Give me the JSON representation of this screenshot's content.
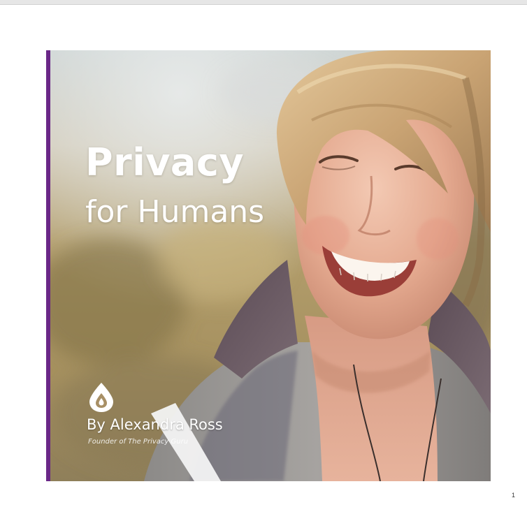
{
  "cover": {
    "title": "Privacy",
    "subtitle": "for Humans",
    "author": "By Alexandra Ross",
    "author_role": "Founder of The Privacy Guru",
    "logo_icon": "droplet-logo-icon"
  },
  "page_number": "1",
  "colors": {
    "spine": "#6a2787",
    "title_text": "#ffffff",
    "background_blur": "#a59a77",
    "sweater": "#6a5a63",
    "hair": "#cba878"
  }
}
